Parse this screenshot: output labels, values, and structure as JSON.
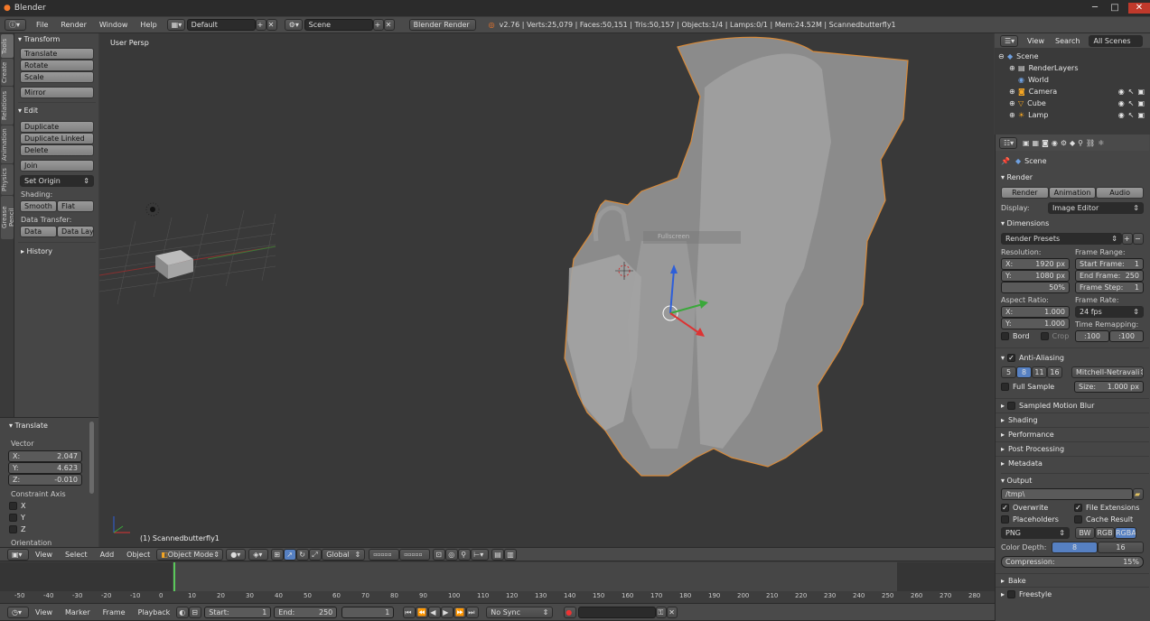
{
  "window": {
    "title": "Blender",
    "min": "─",
    "max": "□",
    "close": "✕"
  },
  "info_header": {
    "menu": [
      "File",
      "Render",
      "Window",
      "Help"
    ],
    "layout": "Default",
    "scene": "Scene",
    "engine": "Blender Render",
    "stats": "v2.76 | Verts:25,079 | Faces:50,151 | Tris:50,157 | Objects:1/4 | Lamps:0/1 | Mem:24.52M | Scannedbutterfly1"
  },
  "toolshelf": {
    "tabs": [
      "Tools",
      "Create",
      "Relations",
      "Animation",
      "Physics",
      "Grease Pencil"
    ],
    "transform_title": "▾ Transform",
    "translate": "Translate",
    "rotate": "Rotate",
    "scale": "Scale",
    "mirror": "Mirror",
    "edit_title": "▾ Edit",
    "duplicate": "Duplicate",
    "duplicate_linked": "Duplicate Linked",
    "delete": "Delete",
    "join": "Join",
    "set_origin": "Set Origin",
    "shading_label": "Shading:",
    "smooth": "Smooth",
    "flat": "Flat",
    "data_transfer_label": "Data Transfer:",
    "data": "Data",
    "data_layo": "Data Layo",
    "history_title": "▸ History"
  },
  "operator": {
    "title": "▾ Translate",
    "vector_label": "Vector",
    "x_label": "X:",
    "x": "2.047",
    "y_label": "Y:",
    "y": "4.623",
    "z_label": "Z:",
    "z": "-0.010",
    "constraint_label": "Constraint Axis",
    "axes": [
      "X",
      "Y",
      "Z"
    ],
    "orientation_label": "Orientation"
  },
  "viewport": {
    "view_label": "User Persp",
    "object_label": "(1) Scannedbutterfly1",
    "overlay_text": "Fullscreen"
  },
  "view3d_header": {
    "menu": [
      "View",
      "Select",
      "Add",
      "Object"
    ],
    "mode": "Object Mode",
    "orientation": "Global"
  },
  "timeline": {
    "ticks": [
      "-50",
      "-40",
      "-30",
      "-20",
      "-10",
      "0",
      "10",
      "20",
      "30",
      "40",
      "50",
      "60",
      "70",
      "80",
      "90",
      "100",
      "110",
      "120",
      "130",
      "140",
      "150",
      "160",
      "170",
      "180",
      "190",
      "200",
      "210",
      "220",
      "230",
      "240",
      "250",
      "260",
      "270",
      "280"
    ],
    "menu": [
      "View",
      "Marker",
      "Frame",
      "Playback"
    ],
    "start_label": "Start:",
    "start": "1",
    "end_label": "End:",
    "end": "250",
    "current": "1",
    "sync": "No Sync"
  },
  "outliner": {
    "menu": [
      "View",
      "Search"
    ],
    "filter": "All Scenes",
    "items": [
      "Scene",
      "RenderLayers",
      "World",
      "Camera",
      "Cube",
      "Lamp"
    ]
  },
  "properties": {
    "context": "Scene",
    "render_title": "▾ Render",
    "render_btn": "Render",
    "animation_btn": "Animation",
    "audio_btn": "Audio",
    "display_label": "Display:",
    "display": "Image Editor",
    "dimensions_title": "▾ Dimensions",
    "presets": "Render Presets",
    "resolution_label": "Resolution:",
    "res_x_label": "X:",
    "res_x": "1920 px",
    "res_y_label": "Y:",
    "res_y": "1080 px",
    "res_pct": "50%",
    "frame_range_label": "Frame Range:",
    "start_frame_label": "Start Frame:",
    "start_frame": "1",
    "end_frame_label": "End Frame:",
    "end_frame": "250",
    "frame_step_label": "Frame Step:",
    "frame_step": "1",
    "aspect_label": "Aspect Ratio:",
    "asp_x_label": "X:",
    "asp_x": "1.000",
    "asp_y_label": "Y:",
    "asp_y": "1.000",
    "frame_rate_label": "Frame Rate:",
    "fps": "24 fps",
    "time_remap_label": "Time Remapping:",
    "remap_old": ":100",
    "remap_new": ":100",
    "bord": "Bord",
    "crop": "Crop",
    "aa_title": "Anti-Aliasing",
    "aa_samples": [
      "5",
      "8",
      "11",
      "16"
    ],
    "aa_filter": "Mitchell-Netravali",
    "full_sample": "Full Sample",
    "size_label": "Size:",
    "size": "1.000 px",
    "collapsed": [
      "Sampled Motion Blur",
      "Shading",
      "Performance",
      "Post Processing",
      "Metadata"
    ],
    "output_title": "▾ Output",
    "path": "/tmp\\",
    "overwrite": "Overwrite",
    "file_ext": "File Extensions",
    "placeholders": "Placeholders",
    "cache_result": "Cache Result",
    "format": "PNG",
    "bw": "BW",
    "rgb": "RGB",
    "rgba": "RGBA",
    "color_depth_label": "Color Depth:",
    "depth8": "8",
    "depth16": "16",
    "compression_label": "Compression:",
    "compression": "15%",
    "bake": "Bake",
    "freestyle": "Freestyle"
  }
}
